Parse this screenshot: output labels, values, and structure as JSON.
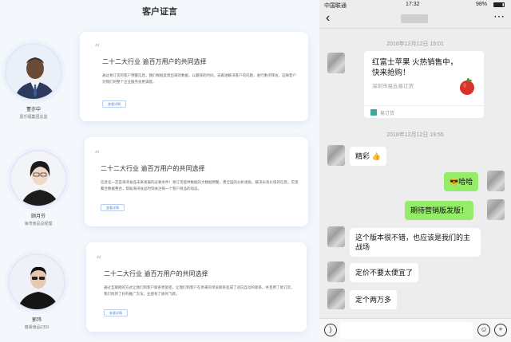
{
  "left": {
    "title": "客户证言",
    "testimonials": [
      {
        "name": "董亦中",
        "role": "嘉乐福集团总监",
        "headline": "二十二大行业 逾百万用户的共同选择",
        "body": "通过易订货的客户预警信息，我们根据反馈出来的数据，以最快的时间，去跟进解决客户的问题，进行重点拜访，这样客户对我们的整个企业服务会更满意。",
        "button": "查看详情"
      },
      {
        "name": "顾月芬",
        "role": "海湾食品总经理",
        "headline": "二十二大行业 逾百万用户的共同选择",
        "body": "信息化一定是海湾食品未来发展的必要条件！易订货提供数据的大数据预警，用全国的分析视角，解决长有价值的信息，实现聚合数据整合，帮助海湾食品时刻关注每一个客户商品的动态。",
        "button": "查看详情"
      },
      {
        "name": "郭玮",
        "role": "春霖食品CEO",
        "headline": "二十二大行业 逾百万用户的共同选择",
        "body": "通过互联网的方式让我们和客户联系更紧密，让我们和客户在原来的单层联系变成了双向互动的联系。并且用了易订货，我们找到了好的推广方法，业绩有了质的飞跃。",
        "button": "查看详情"
      }
    ]
  },
  "phone": {
    "status": {
      "carrier": "中国联通",
      "time": "17:32",
      "battery": "98%"
    },
    "nav": {
      "back": "‹",
      "more": "⋯"
    },
    "timestamps": [
      "2018年12月12日 19:01",
      "2018年12月12日 19:55"
    ],
    "link_card": {
      "title": "红富士苹果 火热销售中，快来抢购！",
      "subtitle": "深圳市易云易订货",
      "source": "易订货"
    },
    "messages": [
      {
        "side": "left",
        "text": "精彩 👍"
      },
      {
        "side": "right",
        "text": "😎哈哈"
      },
      {
        "side": "right",
        "text": "期待营销版发版！"
      },
      {
        "side": "left",
        "text": "这个版本很不错，也应该是我们的主战场"
      },
      {
        "side": "left",
        "text": "定价不要太便宜了"
      },
      {
        "side": "left",
        "text": "定个两万多"
      }
    ],
    "input_icons": [
      "voice-icon",
      "emoji-icon",
      "plus-icon"
    ]
  },
  "colors": {
    "chat_bg": "#ededed",
    "green_bubble": "#95ec69",
    "accent_blue": "#5a8bd8",
    "left_bg": "#f4f8fd"
  }
}
